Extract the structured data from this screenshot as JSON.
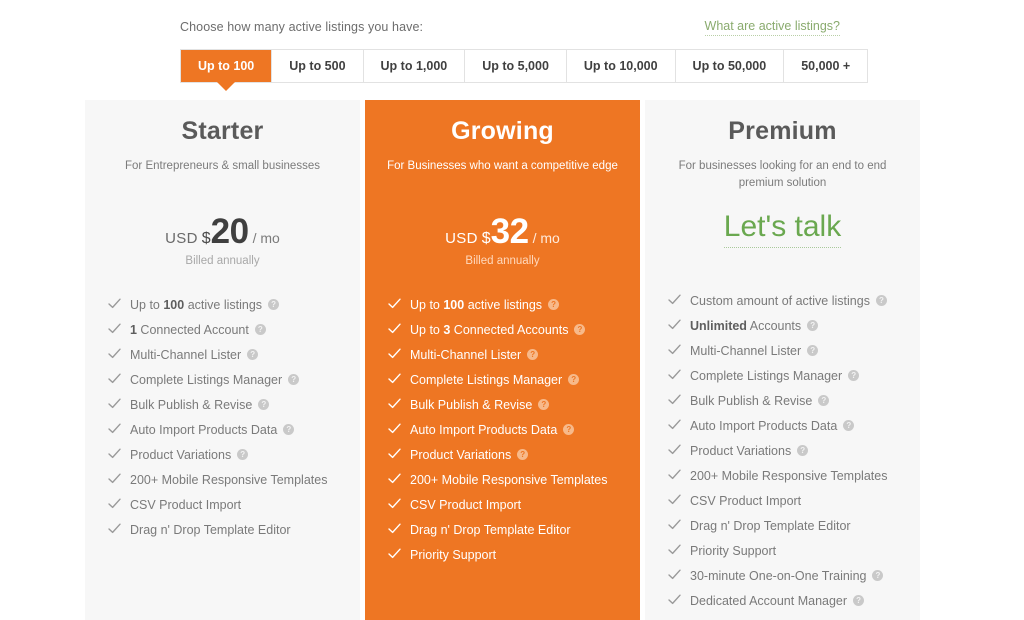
{
  "header": {
    "prompt": "Choose how many active listings you have:",
    "link_label": "What are active listings?"
  },
  "tabs": [
    {
      "label": "Up to 100",
      "active": true
    },
    {
      "label": "Up to 500",
      "active": false
    },
    {
      "label": "Up to 1,000",
      "active": false
    },
    {
      "label": "Up to 5,000",
      "active": false
    },
    {
      "label": "Up to 10,000",
      "active": false
    },
    {
      "label": "Up to 50,000",
      "active": false
    },
    {
      "label": "50,000 +",
      "active": false
    }
  ],
  "plans": [
    {
      "id": "starter",
      "title": "Starter",
      "subtitle": "For Entrepreneurs & small businesses",
      "currency": "USD",
      "dollar_sign": "$",
      "amount": "20",
      "per": "/ mo",
      "billed": "Billed annually",
      "featured": false,
      "features": [
        {
          "text": "Up to 100 active listings",
          "bold": "100",
          "help": true
        },
        {
          "text": "1 Connected Account",
          "bold": "1",
          "help": true
        },
        {
          "text": "Multi-Channel Lister",
          "help": true
        },
        {
          "text": "Complete Listings Manager",
          "help": true
        },
        {
          "text": "Bulk Publish & Revise",
          "help": true
        },
        {
          "text": "Auto Import Products Data",
          "help": true
        },
        {
          "text": "Product Variations",
          "help": true
        },
        {
          "text": "200+ Mobile Responsive Templates",
          "help": false
        },
        {
          "text": "CSV Product Import",
          "help": false
        },
        {
          "text": "Drag n' Drop Template Editor",
          "help": false
        }
      ]
    },
    {
      "id": "growing",
      "title": "Growing",
      "subtitle": "For Businesses who want a competitive edge",
      "currency": "USD",
      "dollar_sign": "$",
      "amount": "32",
      "per": "/ mo",
      "billed": "Billed annually",
      "featured": true,
      "features": [
        {
          "text": "Up to 100 active listings",
          "bold": "100",
          "help": true
        },
        {
          "text": "Up to 3 Connected Accounts",
          "bold": "3",
          "help": true
        },
        {
          "text": "Multi-Channel Lister",
          "help": true
        },
        {
          "text": "Complete Listings Manager",
          "help": true
        },
        {
          "text": "Bulk Publish & Revise",
          "help": true
        },
        {
          "text": "Auto Import Products Data",
          "help": true
        },
        {
          "text": "Product Variations",
          "help": true
        },
        {
          "text": "200+ Mobile Responsive Templates",
          "help": false
        },
        {
          "text": "CSV Product Import",
          "help": false
        },
        {
          "text": "Drag n' Drop Template Editor",
          "help": false
        },
        {
          "text": "Priority Support",
          "help": false
        }
      ]
    },
    {
      "id": "premium",
      "title": "Premium",
      "subtitle": "For businesses looking for an end to end premium solution",
      "cta_label": "Let's talk",
      "featured": false,
      "features": [
        {
          "text": "Custom amount of active listings",
          "help": true
        },
        {
          "text": "Unlimited Accounts",
          "bold": "Unlimited",
          "help": true
        },
        {
          "text": "Multi-Channel Lister",
          "help": true
        },
        {
          "text": "Complete Listings Manager",
          "help": true
        },
        {
          "text": "Bulk Publish & Revise",
          "help": true
        },
        {
          "text": "Auto Import Products Data",
          "help": true
        },
        {
          "text": "Product Variations",
          "help": true
        },
        {
          "text": "200+ Mobile Responsive Templates",
          "help": false
        },
        {
          "text": "CSV Product Import",
          "help": false
        },
        {
          "text": "Drag n' Drop Template Editor",
          "help": false
        },
        {
          "text": "Priority Support",
          "help": false
        },
        {
          "text": "30-minute One-on-One Training",
          "help": true
        },
        {
          "text": "Dedicated Account Manager",
          "help": true
        }
      ]
    }
  ],
  "icons": {
    "help_glyph": "?"
  },
  "colors": {
    "accent_orange": "#ee7623",
    "link_green": "#8aab6e",
    "cta_green": "#6aa84f",
    "card_bg": "#f7f7f7"
  }
}
